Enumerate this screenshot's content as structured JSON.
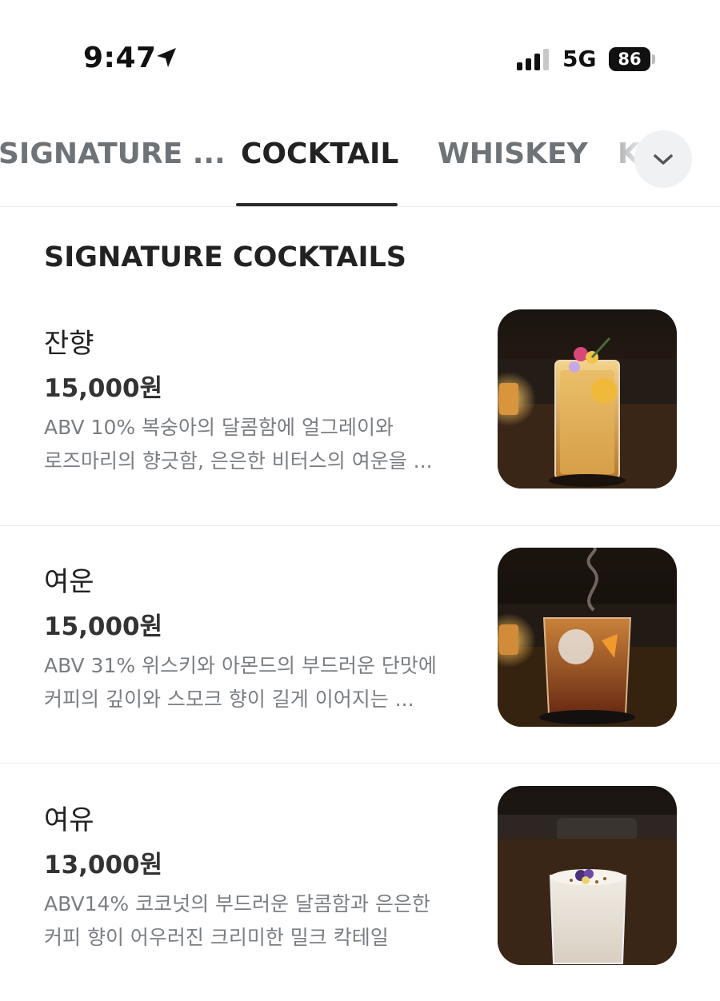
{
  "status": {
    "time": "9:47",
    "network": "5G",
    "battery": "86",
    "icons": [
      "location-arrow-icon",
      "cellular-signal-icon",
      "battery-icon"
    ]
  },
  "tabs": {
    "items": [
      "SIGNATURE ...",
      "COCKTAIL",
      "WHISKEY",
      "K"
    ],
    "active": "COCKTAIL",
    "more_icon": "chevron-down-icon"
  },
  "section": {
    "title": "SIGNATURE COCKTAILS"
  },
  "items": [
    {
      "name": "잔향",
      "price": "15,000원",
      "desc_line1": "ABV 10% 복숭아의 달콤함에 얼그레이와",
      "desc_line2": "로즈마리의 향긋함, 은은한 비터스의 여운을 ..."
    },
    {
      "name": "여운",
      "price": "15,000원",
      "desc_line1": "ABV 31% 위스키와 아몬드의 부드러운 단맛에",
      "desc_line2": "커피의 깊이와 스모크 향이 길게 이어지는 ..."
    },
    {
      "name": "여유",
      "price": "13,000원",
      "desc_line1": "ABV14% 코코넛의 부드러운 달콤함과 은은한",
      "desc_line2": "커피 향이 어우러진 크리미한 밀크 칵테일"
    }
  ],
  "colors": {
    "text_primary": "#222222",
    "text_muted": "#7a7e82",
    "tab_inactive": "#6e7378",
    "divider": "#ececec"
  }
}
